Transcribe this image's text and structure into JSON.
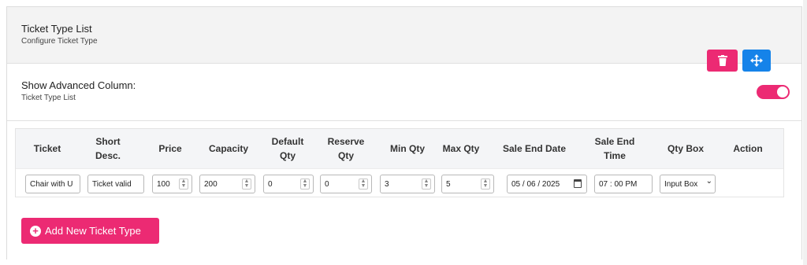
{
  "header": {
    "title": "Ticket Type List",
    "subtitle": "Configure Ticket Type"
  },
  "advanced": {
    "title": "Show Advanced Column:",
    "subtitle": "Ticket Type List",
    "toggle_on": true,
    "toggle_color": "#ec2a73"
  },
  "table": {
    "columns": [
      {
        "label": "Ticket"
      },
      {
        "label": "Short Desc."
      },
      {
        "label": "Price"
      },
      {
        "label": "Capacity"
      },
      {
        "label": "Default Qty"
      },
      {
        "label": "Reserve Qty"
      },
      {
        "label": "Min Qty"
      },
      {
        "label": "Max Qty"
      },
      {
        "label": "Sale End Date"
      },
      {
        "label": "Sale End Time"
      },
      {
        "label": "Qty Box"
      },
      {
        "label": "Action"
      }
    ],
    "row": {
      "ticket": "Chair with U",
      "short_desc": "Ticket valid",
      "price": "100",
      "capacity": "200",
      "default_qty": "0",
      "reserve_qty": "0",
      "min_qty": "3",
      "max_qty": "5",
      "sale_end_date": "05 / 06 / 2025",
      "sale_end_time": "07 : 00  PM",
      "qty_box": "Input Box"
    },
    "icons": {
      "delete": "trash-icon",
      "move": "move-arrows-icon",
      "calendar": "calendar-icon",
      "spinner": "spinner-arrows-icon",
      "select": "chevron-down-icon"
    }
  },
  "add_button": {
    "label": "Add New Ticket Type",
    "icon": "plus-circle-icon",
    "color": "#ec2a73"
  },
  "colors": {
    "accent_pink": "#ec2a73",
    "accent_blue": "#1583e9"
  }
}
